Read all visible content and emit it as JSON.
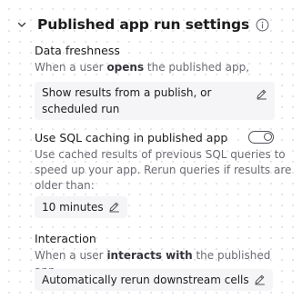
{
  "header": {
    "title": "Published app run settings",
    "icons": {
      "collapse": "chevron-down-icon",
      "info": "info-icon"
    }
  },
  "data_freshness": {
    "label": "Data freshness",
    "desc_before": "When a user ",
    "desc_bold": "opens",
    "desc_after": " the published app,",
    "option_value": "Show results from a publish, or scheduled run",
    "edit_icon": "pencil-icon"
  },
  "sql_caching": {
    "label": "Use SQL caching in published app",
    "toggle_on": true,
    "description": "Use cached results of previous SQL queries to speed up your app. Rerun queries if results are older than:",
    "duration_value": "10 minutes",
    "edit_icon": "pencil-icon"
  },
  "interaction": {
    "label": "Interaction",
    "desc_before": "When a user ",
    "desc_bold": "interacts with",
    "desc_after": " the published app,",
    "option_value": "Automatically rerun downstream cells",
    "edit_icon": "pencil-icon"
  },
  "colors": {
    "text_primary": "#1c1c1e",
    "text_secondary": "#6b6b73",
    "chip_background": "#f5f5f7",
    "icon_stroke": "#52525a"
  }
}
